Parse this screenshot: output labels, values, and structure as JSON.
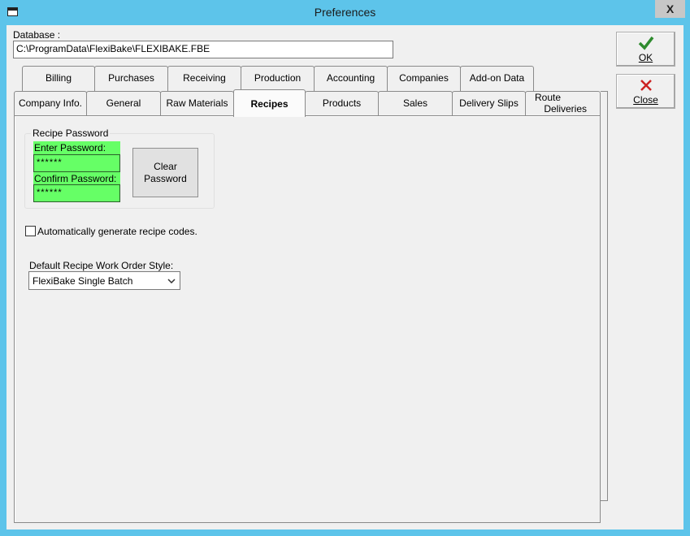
{
  "window": {
    "title": "Preferences",
    "close_glyph": "X",
    "app_icon": "window-icon"
  },
  "database": {
    "label": "Database :",
    "path": "C:\\ProgramData\\FlexiBake\\FLEXIBAKE.FBE"
  },
  "buttons": {
    "ok": {
      "label": "OK",
      "icon": "checkmark-icon",
      "color": "#2e8b2e"
    },
    "close": {
      "label": "Close",
      "icon": "red-x-icon",
      "color": "#cc2222"
    }
  },
  "tabs_row1": [
    "Billing",
    "Purchases",
    "Receiving",
    "Production",
    "Accounting",
    "Companies",
    "Add-on Data"
  ],
  "tabs_row2": [
    "Company Info.",
    "General",
    "Raw Materials",
    "Recipes",
    "Products",
    "Sales",
    "Delivery Slips"
  ],
  "tab_route": {
    "line1": "Route",
    "line2": "Deliveries"
  },
  "active_tab": "Recipes",
  "recipes": {
    "password_group": "Recipe Password",
    "enter_label": "Enter Password:",
    "enter_value": "******",
    "confirm_label": "Confirm Password:",
    "confirm_value": "******",
    "clear_line1": "Clear",
    "clear_line2": "Password",
    "auto_codes_label": "Automatically generate recipe codes.",
    "auto_codes_checked": false,
    "work_order_label": "Default Recipe Work Order Style:",
    "work_order_value": "FlexiBake Single Batch",
    "highlight_color": "#66ff66"
  }
}
